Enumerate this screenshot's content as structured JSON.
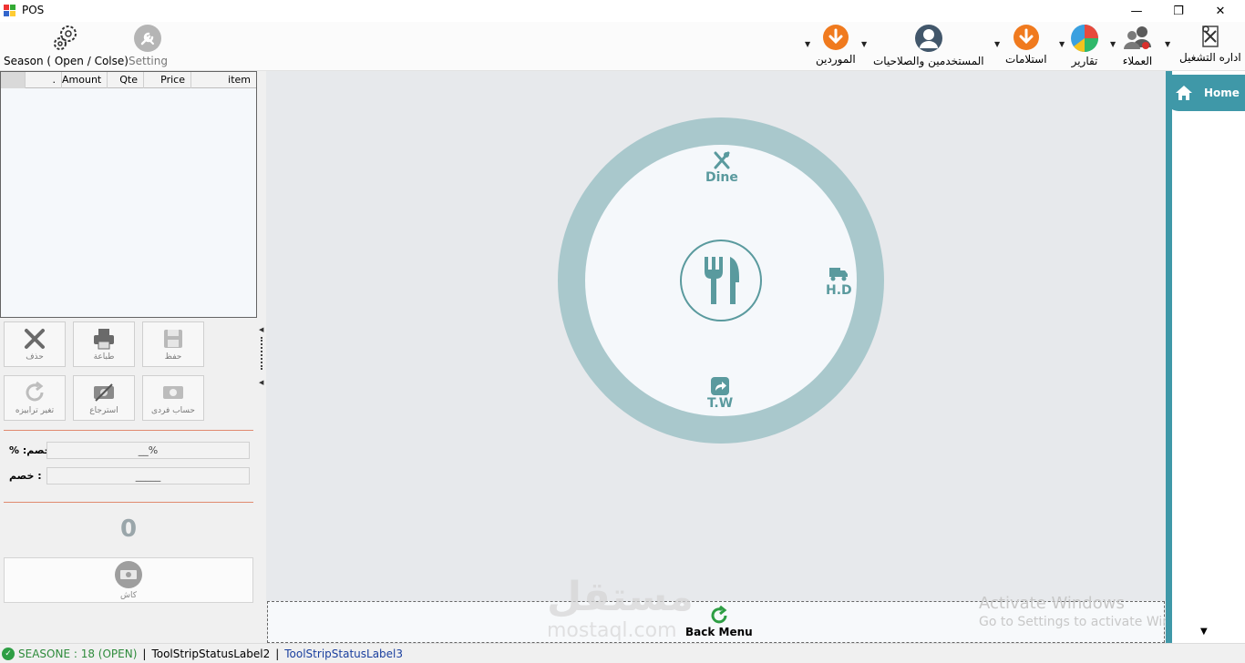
{
  "window": {
    "title": "POS",
    "controls": {
      "minimize": "—",
      "restore": "❐",
      "close": "✕"
    }
  },
  "toolbar": {
    "left_items": [
      {
        "label": "Season ( Open / Colse)",
        "icon": "gears-icon"
      },
      {
        "label": "Setting",
        "icon": "wrench-icon"
      }
    ],
    "right_items": [
      {
        "label": "الموردين",
        "icon": "download-arrow-icon"
      },
      {
        "label": "المستخدمين والصلاحيات",
        "icon": "user-icon"
      },
      {
        "label": "استلامات",
        "icon": "download-arrow-icon"
      },
      {
        "label": "تقارير",
        "icon": "pie-chart-icon"
      },
      {
        "label": "العملاء",
        "icon": "users-icon"
      },
      {
        "label": "اداره التشغيل",
        "icon": "tools-icon"
      }
    ]
  },
  "order_grid": {
    "columns": [
      ".",
      "Amount",
      "Qte",
      "Price",
      "item"
    ]
  },
  "actions": {
    "delete": "حذف",
    "print": "طباعة",
    "save": "حفظ",
    "change_table": "تغير ترابيزه",
    "refund": "استرجاع",
    "split_bill": "حساب فردى"
  },
  "discount": {
    "percent_label": "% :خصم",
    "percent_value": "__%",
    "amount_label": "خصم :",
    "amount_value": "_____"
  },
  "total": "0",
  "cash_label": "كاش",
  "order_types": {
    "dine": "Dine",
    "home_delivery": "H.D",
    "take_away": "T.W"
  },
  "back_menu": "Back Menu",
  "side_nav": {
    "home": "Home"
  },
  "watermark": {
    "logo": "مستقل",
    "sub": "mostaql.com"
  },
  "activation": {
    "line1": "Activate Windows",
    "line2": "Go to Settings to activate Windows."
  },
  "status": {
    "season": "SEASONE : 18 (OPEN)",
    "label2": "ToolStripStatusLabel2",
    "label3": "ToolStripStatusLabel3"
  },
  "colors": {
    "accent": "#3f98a8",
    "ring": "#a9c8cc",
    "icon_teal": "#5a9a9e",
    "status_green": "#2e9e44",
    "orange": "#f07a1e"
  }
}
